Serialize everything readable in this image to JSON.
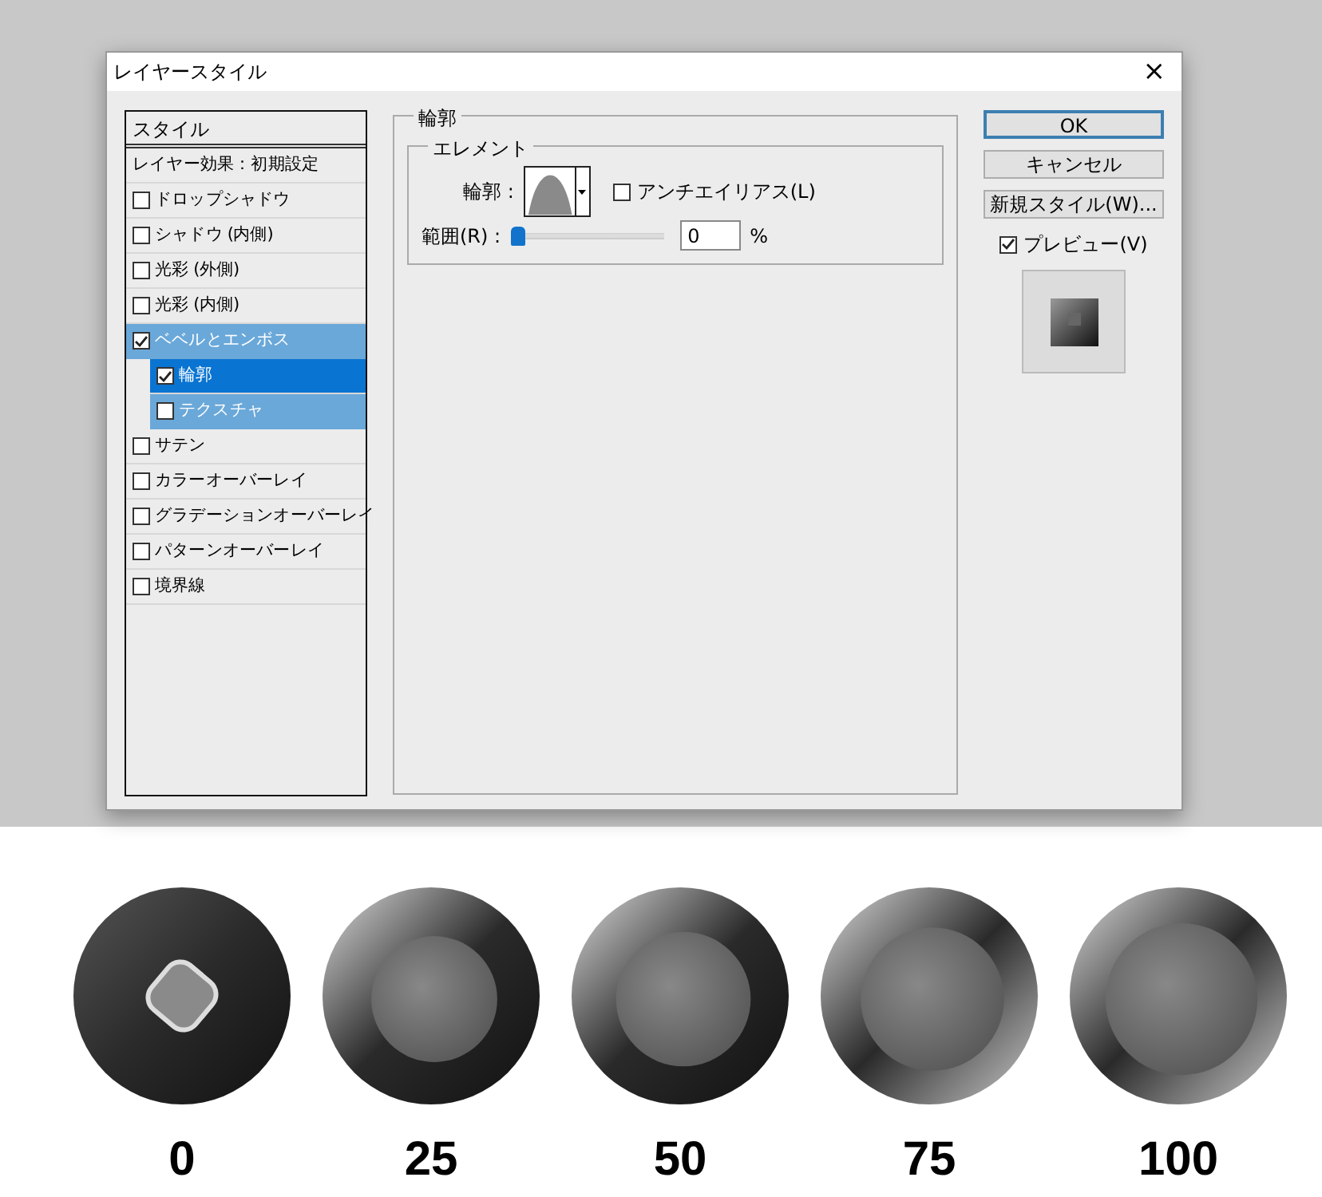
{
  "window": {
    "title": "レイヤースタイル",
    "close": "×"
  },
  "styles_list": {
    "header": "スタイル",
    "items": [
      {
        "label": "レイヤー効果：初期設定",
        "kind": "heading"
      },
      {
        "label": "ドロップシャドウ",
        "kind": "check",
        "checked": false,
        "selected": false,
        "expanded": false
      },
      {
        "label": "シャドウ (内側)",
        "kind": "check",
        "checked": false,
        "selected": false,
        "expanded": false
      },
      {
        "label": "光彩 (外側)",
        "kind": "check",
        "checked": false,
        "selected": false,
        "expanded": false
      },
      {
        "label": "光彩 (内側)",
        "kind": "check",
        "checked": false,
        "selected": false,
        "expanded": false
      },
      {
        "label": "ベベルとエンボス",
        "kind": "check",
        "checked": true,
        "selected": false,
        "expanded": true,
        "children": [
          {
            "label": "輪郭",
            "kind": "check",
            "checked": true,
            "selected": true
          },
          {
            "label": "テクスチャ",
            "kind": "check",
            "checked": false,
            "selected": false
          }
        ]
      },
      {
        "label": "サテン",
        "kind": "check",
        "checked": false,
        "selected": false,
        "expanded": false
      },
      {
        "label": "カラーオーバーレイ",
        "kind": "check",
        "checked": false,
        "selected": false,
        "expanded": false
      },
      {
        "label": "グラデーションオーバーレイ",
        "kind": "check",
        "checked": false,
        "selected": false,
        "expanded": false
      },
      {
        "label": "パターンオーバーレイ",
        "kind": "check",
        "checked": false,
        "selected": false,
        "expanded": false
      },
      {
        "label": "境界線",
        "kind": "check",
        "checked": false,
        "selected": false,
        "expanded": false
      }
    ]
  },
  "contour_panel": {
    "title": "輪郭",
    "element_group": {
      "title": "エレメント",
      "contour_label": "輪郭 :",
      "antialias": {
        "label": "アンチエイリアス(L)",
        "checked": false
      },
      "range_label": "範囲(R) :",
      "range": {
        "level": 0
      },
      "range_value": "0",
      "unit": "%"
    }
  },
  "buttons": [
    {
      "label": "OK",
      "default": true
    },
    {
      "label": "キャンセル",
      "default": false
    },
    {
      "label": "新規スタイル(W)...",
      "default": false
    }
  ],
  "preview": {
    "label": "プレビュー(V)",
    "checked": true
  },
  "samples": [
    {
      "label": "0"
    },
    {
      "label": "25"
    },
    {
      "label": "50"
    },
    {
      "label": "75"
    },
    {
      "label": "100"
    }
  ]
}
